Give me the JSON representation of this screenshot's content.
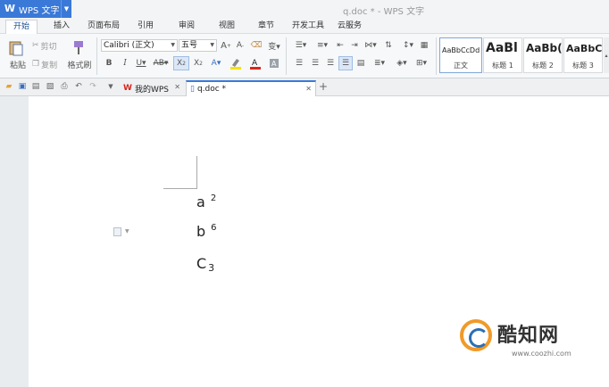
{
  "app": {
    "menu_label": "WPS 文字",
    "window_title": "q.doc * - WPS 文字"
  },
  "menu_tabs": [
    "开始",
    "插入",
    "页面布局",
    "引用",
    "审阅",
    "视图",
    "章节",
    "开发工具",
    "云服务"
  ],
  "ribbon": {
    "paste_label": "粘贴",
    "cut_label": "剪切",
    "copy_label": "复制",
    "format_painter_label": "格式刷",
    "font_name": "Calibri (正文)",
    "font_size": "五号",
    "styles": [
      {
        "sample": "AaBbCcDd",
        "label": "正文"
      },
      {
        "sample": "AaBl",
        "label": "标题 1"
      },
      {
        "sample": "AaBb(",
        "label": "标题 2"
      },
      {
        "sample": "AaBbC",
        "label": "标题 3"
      }
    ]
  },
  "doc_tabs": [
    {
      "label": "我的WPS"
    },
    {
      "label": "q.doc *"
    }
  ],
  "document": {
    "lines": [
      {
        "base": "a",
        "script": "2",
        "kind": "superscript"
      },
      {
        "base": "b",
        "script": "6",
        "kind": "superscript"
      },
      {
        "base": "C",
        "script": "3",
        "kind": "subscript"
      }
    ]
  },
  "watermark": {
    "brand": "酷知网",
    "url": "www.coozhi.com"
  },
  "colors": {
    "accent": "#3a79d8",
    "font_color_bar": "#d9261c",
    "highlight_bar": "#f5e300"
  }
}
